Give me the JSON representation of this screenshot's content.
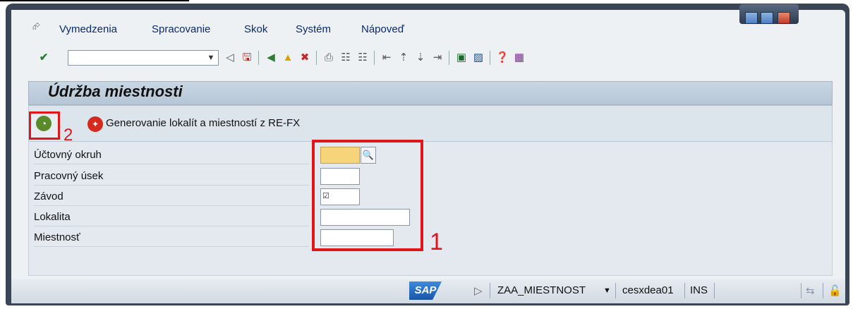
{
  "menu": {
    "items": [
      {
        "label": "Vymedzenia"
      },
      {
        "label": "Spracovanie"
      },
      {
        "label": "Skok"
      },
      {
        "label": "Systém"
      },
      {
        "label": "Nápoveď"
      }
    ]
  },
  "window_controls": [
    "minimize-icon",
    "maximize-icon",
    "close-icon"
  ],
  "toolbar": {
    "command_field": "",
    "icons": [
      "enter-icon",
      "back-triangle-icon",
      "save-icon",
      "back-icon",
      "exit-icon",
      "cancel-icon",
      "print-icon",
      "find-icon",
      "find-next-icon",
      "first-page-icon",
      "previous-page-icon",
      "next-page-icon",
      "last-page-icon",
      "new-session-icon",
      "shortcut-icon",
      "help-icon",
      "layout-icon"
    ]
  },
  "page": {
    "title": "Údržba miestnosti"
  },
  "app_toolbar": {
    "execute_icon": "execute-clock-icon",
    "generate_label": "Generovanie lokalít a miestností z RE-FX",
    "annotation_2": "2"
  },
  "form": {
    "fields": [
      {
        "label": "Účtovný okruh",
        "value": ""
      },
      {
        "label": "Pracovný úsek",
        "value": ""
      },
      {
        "label": "Závod",
        "value": ""
      },
      {
        "label": "Lokalita",
        "value": ""
      },
      {
        "label": "Miestnosť",
        "value": ""
      }
    ],
    "annotation_1": "1"
  },
  "status": {
    "logo": "SAP",
    "transaction": "ZAA_MIESTNOST",
    "server": "cesxdea01",
    "mode": "INS"
  },
  "colors": {
    "highlight": "#e0161b",
    "frame": "#3a4655",
    "title_bg": "#c9d6e3"
  }
}
